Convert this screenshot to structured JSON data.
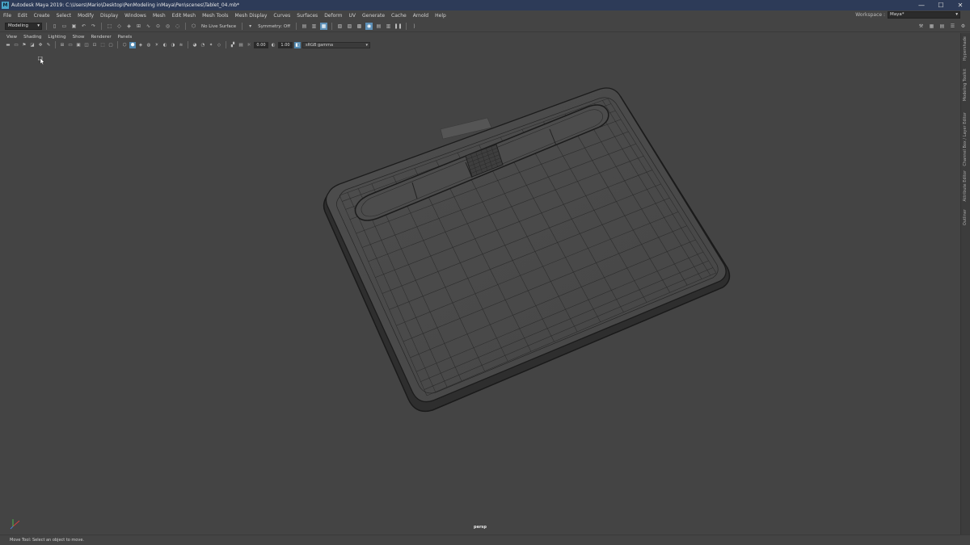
{
  "window": {
    "app_icon": "M",
    "title": "Autodesk Maya 2019: C:\\Users\\Mario\\Desktop\\PenModeling inMaya\\Pen\\scenes\\Tablet_04.mb*",
    "controls": {
      "minimize": "—",
      "maximize": "☐",
      "close": "✕"
    }
  },
  "menubar": {
    "items": [
      "File",
      "Edit",
      "Create",
      "Select",
      "Modify",
      "Display",
      "Windows",
      "Mesh",
      "Edit Mesh",
      "Mesh Tools",
      "Mesh Display",
      "Curves",
      "Surfaces",
      "Deform",
      "UV",
      "Generate",
      "Cache",
      "Arnold",
      "Help"
    ],
    "workspace_label": "Workspace :",
    "workspace_value": "Maya*"
  },
  "statusline": {
    "mode": "Modeling",
    "live_surface": "No Live Surface",
    "symmetry": "Symmetry: Off"
  },
  "panel": {
    "menu": [
      "View",
      "Shading",
      "Lighting",
      "Show",
      "Renderer",
      "Panels"
    ],
    "field_a": "0.00",
    "field_b": "1.00",
    "color_space": "sRGB gamma"
  },
  "viewport": {
    "camera": "persp"
  },
  "sidetabs": [
    "Hypershade",
    "Modeling Toolkit",
    "Channel Box / Layer Editor",
    "Attribute Editor",
    "Outliner"
  ],
  "helpline": {
    "text": "Move Tool: Select an object to move."
  },
  "colors": {
    "titlebar": "#2d3b58",
    "ui_background": "#444444",
    "accent": "#5d8fb6",
    "mesh_surface": "#4a4a4a",
    "wireframe": "#1e1e1e"
  }
}
